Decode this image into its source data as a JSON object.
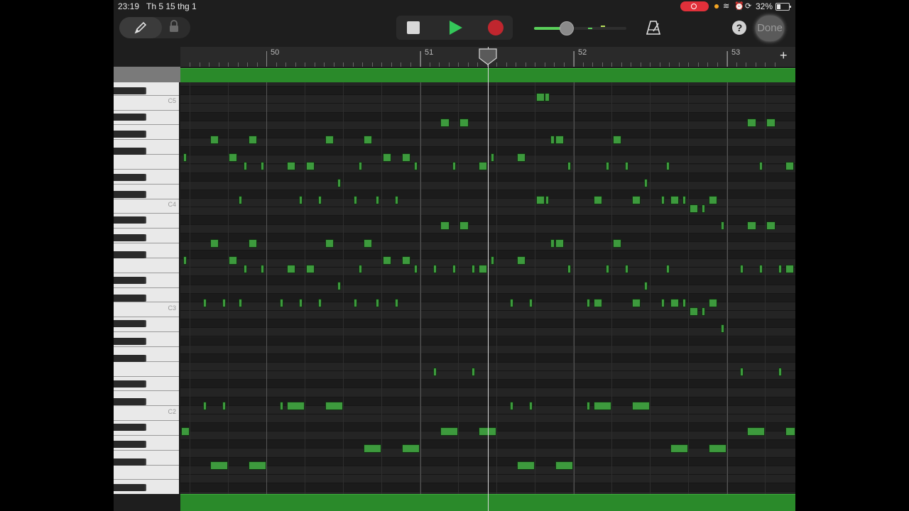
{
  "status_bar": {
    "time": "23:19",
    "date": "Th 5 15 thg 1",
    "battery": "32%"
  },
  "toolbar": {
    "done_label": "Done",
    "help_label": "?",
    "icons": [
      "pencil-icon",
      "lock-icon",
      "stop-icon",
      "play-icon",
      "record-icon",
      "metronome-icon",
      "help-icon"
    ],
    "accent_color": "#34c759",
    "record_color": "#c0262e"
  },
  "ruler": {
    "bars": [
      "50",
      "51",
      "52",
      "53"
    ],
    "add_label": "+"
  },
  "piano": {
    "octave_labels": [
      "C5",
      "C4",
      "C3",
      "C2"
    ]
  },
  "note_color": "#3d9a3d",
  "region_color": "#2a8a2a"
}
